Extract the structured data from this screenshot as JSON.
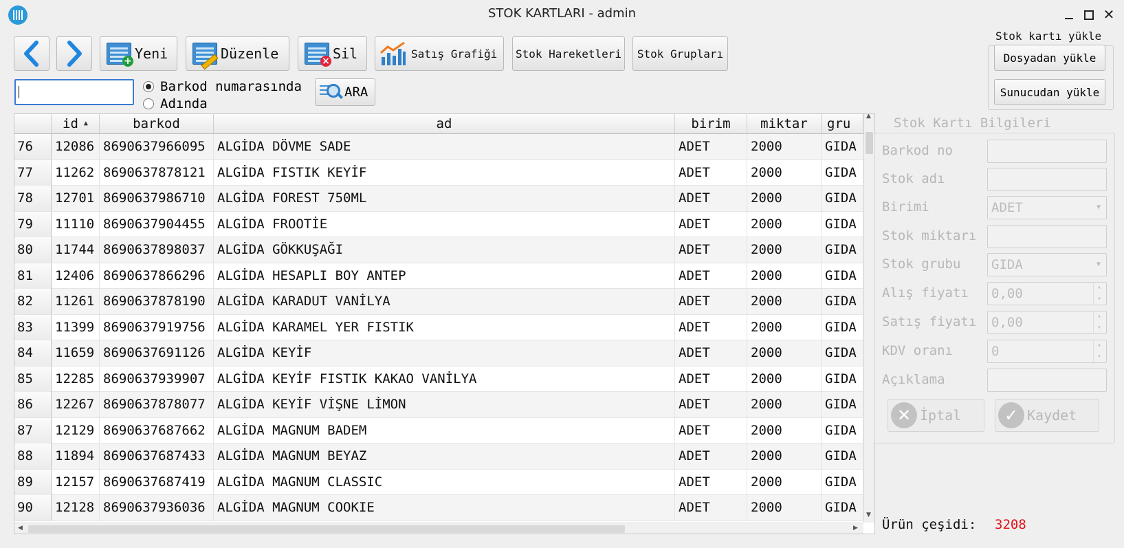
{
  "window": {
    "title": "STOK KARTLARI - admin",
    "close_glyph": "✕"
  },
  "toolbar": {
    "prev_icon": "chevron-left-icon",
    "next_icon": "chevron-right-icon",
    "new_label": "Yeni",
    "edit_label": "Düzenle",
    "delete_label": "Sil",
    "chart_label": "Satış Grafiği",
    "movements_label": "Stok Hareketleri",
    "groups_label": "Stok Grupları"
  },
  "upload": {
    "group_title": "Stok kartı yükle",
    "from_file": "Dosyadan yükle",
    "from_server": "Sunucudan yükle"
  },
  "search": {
    "value": "",
    "option_barcode": "Barkod numarasında",
    "option_name": "Adında",
    "selected": "barcode",
    "button_label": "ARA"
  },
  "table": {
    "columns": [
      "id",
      "barkod",
      "ad",
      "birim",
      "miktar",
      "gru"
    ],
    "sort_column": "id",
    "sort_indicator": "▲",
    "rows": [
      {
        "row": "76",
        "id": "12086",
        "barkod": "8690637966095",
        "ad": "ALGİDA DÖVME SADE",
        "birim": "ADET",
        "miktar": "2000",
        "grup": "GIDA"
      },
      {
        "row": "77",
        "id": "11262",
        "barkod": "8690637878121",
        "ad": "ALGİDA FISTIK KEYİF",
        "birim": "ADET",
        "miktar": "2000",
        "grup": "GIDA"
      },
      {
        "row": "78",
        "id": "12701",
        "barkod": "8690637986710",
        "ad": "ALGİDA FOREST 750ML",
        "birim": "ADET",
        "miktar": "2000",
        "grup": "GIDA"
      },
      {
        "row": "79",
        "id": "11110",
        "barkod": "8690637904455",
        "ad": "ALGİDA FROOTİE",
        "birim": "ADET",
        "miktar": "2000",
        "grup": "GIDA"
      },
      {
        "row": "80",
        "id": "11744",
        "barkod": "8690637898037",
        "ad": "ALGİDA GÖKKUŞAĞI",
        "birim": "ADET",
        "miktar": "2000",
        "grup": "GIDA"
      },
      {
        "row": "81",
        "id": "12406",
        "barkod": "8690637866296",
        "ad": "ALGİDA HESAPLI BOY ANTEP",
        "birim": "ADET",
        "miktar": "2000",
        "grup": "GIDA"
      },
      {
        "row": "82",
        "id": "11261",
        "barkod": "8690637878190",
        "ad": "ALGİDA KARADUT VANİLYA",
        "birim": "ADET",
        "miktar": "2000",
        "grup": "GIDA"
      },
      {
        "row": "83",
        "id": "11399",
        "barkod": "8690637919756",
        "ad": "ALGİDA KARAMEL YER FISTIK",
        "birim": "ADET",
        "miktar": "2000",
        "grup": "GIDA"
      },
      {
        "row": "84",
        "id": "11659",
        "barkod": "8690637691126",
        "ad": "ALGİDA KEYİF",
        "birim": "ADET",
        "miktar": "2000",
        "grup": "GIDA"
      },
      {
        "row": "85",
        "id": "12285",
        "barkod": "8690637939907",
        "ad": "ALGİDA KEYİF FISTIK KAKAO VANİLYA",
        "birim": "ADET",
        "miktar": "2000",
        "grup": "GIDA"
      },
      {
        "row": "86",
        "id": "12267",
        "barkod": "8690637878077",
        "ad": "ALGİDA KEYİF VİŞNE LİMON",
        "birim": "ADET",
        "miktar": "2000",
        "grup": "GIDA"
      },
      {
        "row": "87",
        "id": "12129",
        "barkod": "8690637687662",
        "ad": "ALGİDA MAGNUM BADEM",
        "birim": "ADET",
        "miktar": "2000",
        "grup": "GIDA"
      },
      {
        "row": "88",
        "id": "11894",
        "barkod": "8690637687433",
        "ad": "ALGİDA MAGNUM BEYAZ",
        "birim": "ADET",
        "miktar": "2000",
        "grup": "GIDA"
      },
      {
        "row": "89",
        "id": "12157",
        "barkod": "8690637687419",
        "ad": "ALGİDA MAGNUM CLASSIC",
        "birim": "ADET",
        "miktar": "2000",
        "grup": "GIDA"
      },
      {
        "row": "90",
        "id": "12128",
        "barkod": "8690637936036",
        "ad": "ALGİDA MAGNUM COOKIE",
        "birim": "ADET",
        "miktar": "2000",
        "grup": "GIDA"
      }
    ]
  },
  "details": {
    "title": "Stok Kartı Bilgileri",
    "barcode_label": "Barkod no",
    "barcode_value": "",
    "name_label": "Stok adı",
    "name_value": "",
    "unit_label": "Birimi",
    "unit_value": "ADET",
    "qty_label": "Stok miktarı",
    "qty_value": "",
    "group_label": "Stok grubu",
    "group_value": "GIDA",
    "buy_label": "Alış fiyatı",
    "buy_value": "0,00",
    "sell_label": "Satış fiyatı",
    "sell_value": "0,00",
    "vat_label": "KDV oranı",
    "vat_value": "0",
    "desc_label": "Açıklama",
    "desc_value": "",
    "cancel_label": "İptal",
    "save_label": "Kaydet",
    "enabled": false
  },
  "summary": {
    "count_label": "Ürün çeşidi:",
    "count_value": "3208"
  },
  "colors": {
    "accent": "#3a7bd5",
    "count": "#e0121a",
    "disabled_text": "#b7b7b7"
  }
}
